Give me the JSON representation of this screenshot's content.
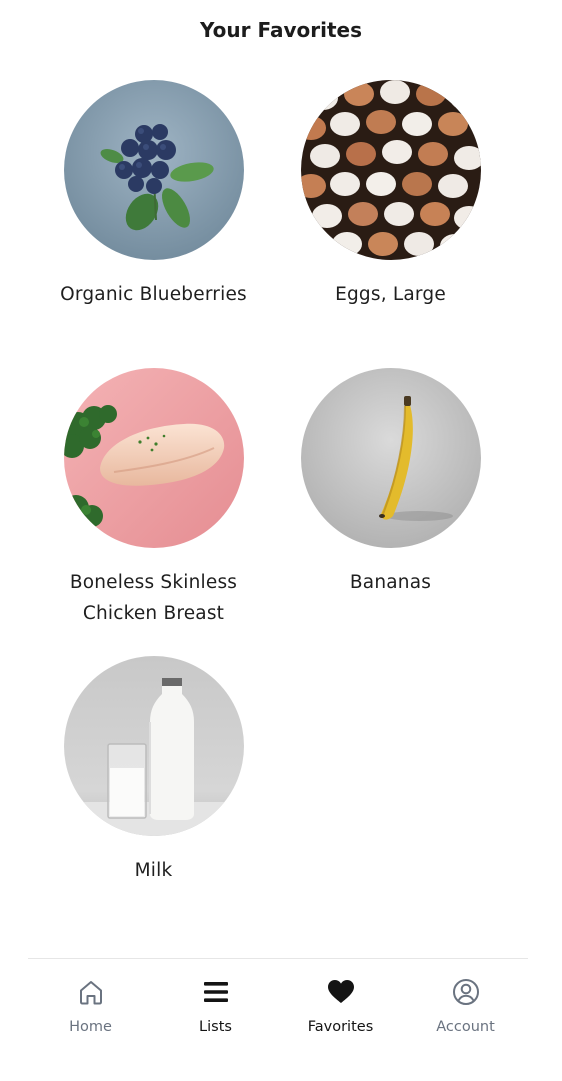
{
  "header": {
    "title": "Your Favorites"
  },
  "favorites": [
    {
      "label": "Organic Blueberries",
      "image": "blueberries-photo"
    },
    {
      "label": "Eggs, Large",
      "image": "eggs-photo"
    },
    {
      "label": "Boneless Skinless Chicken Breast",
      "image": "chicken-breast-photo"
    },
    {
      "label": "Bananas",
      "image": "banana-photo"
    },
    {
      "label": "Milk",
      "image": "milk-photo"
    }
  ],
  "nav": {
    "items": [
      {
        "label": "Home",
        "icon": "home-icon"
      },
      {
        "label": "Lists",
        "icon": "list-icon"
      },
      {
        "label": "Favorites",
        "icon": "heart-icon"
      },
      {
        "label": "Account",
        "icon": "account-icon"
      }
    ],
    "active": "Favorites"
  },
  "colors": {
    "nav_inactive": "#6a7380",
    "nav_active": "#141414",
    "text": "#1f1f1f"
  }
}
